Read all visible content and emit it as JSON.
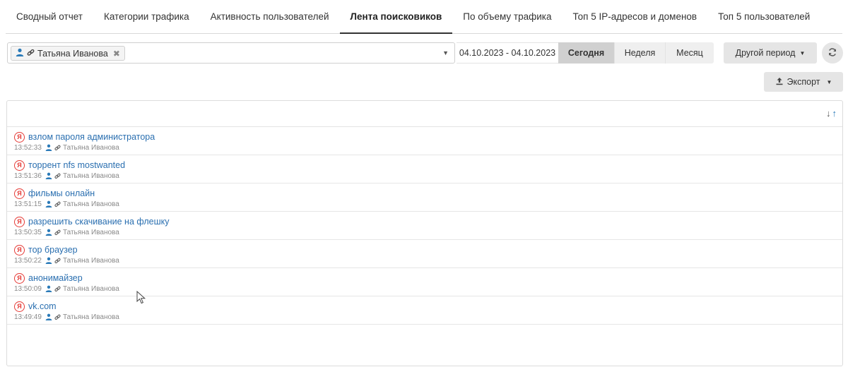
{
  "tabs": [
    {
      "label": "Сводный отчет",
      "active": false
    },
    {
      "label": "Категории трафика",
      "active": false
    },
    {
      "label": "Активность пользователей",
      "active": false
    },
    {
      "label": "Лента поисковиков",
      "active": true
    },
    {
      "label": "По объему трафика",
      "active": false
    },
    {
      "label": "Топ 5 IP-адресов и доменов",
      "active": false
    },
    {
      "label": "Топ 5 пользователей",
      "active": false
    }
  ],
  "filter": {
    "user_chip": "Татьяна Иванова",
    "chip_remove": "✖",
    "date_range": "04.10.2023 - 04.10.2023",
    "periods": [
      {
        "label": "Сегодня",
        "active": true
      },
      {
        "label": "Неделя",
        "active": false
      },
      {
        "label": "Месяц",
        "active": false
      }
    ],
    "other_period": "Другой период",
    "export": "Экспорт"
  },
  "feed": {
    "items": [
      {
        "query": "взлом пароля администратора",
        "time": "13:52:33",
        "user": "Татьяна Иванова"
      },
      {
        "query": "торрент nfs mostwanted",
        "time": "13:51:36",
        "user": "Татьяна Иванова"
      },
      {
        "query": "фильмы онлайн",
        "time": "13:51:15",
        "user": "Татьяна Иванова"
      },
      {
        "query": "разрешить скачивание на флешку",
        "time": "13:50:35",
        "user": "Татьяна Иванова"
      },
      {
        "query": "тор браузер",
        "time": "13:50:22",
        "user": "Татьяна Иванова"
      },
      {
        "query": "анонимайзер",
        "time": "13:50:09",
        "user": "Татьяна Иванова"
      },
      {
        "query": "vk.com",
        "time": "13:49:49",
        "user": "Татьяна Иванова"
      }
    ]
  },
  "icons": {
    "search_engine": "yandex-icon",
    "user": "user-icon",
    "link": "link-icon",
    "sort_desc": "arrow-down-icon",
    "sort_asc": "arrow-up-icon"
  },
  "colors": {
    "link": "#2a6fb0",
    "user_icon": "#2a7ab8",
    "yandex": "#e53935",
    "active_period_bg": "#d0d0d0"
  }
}
